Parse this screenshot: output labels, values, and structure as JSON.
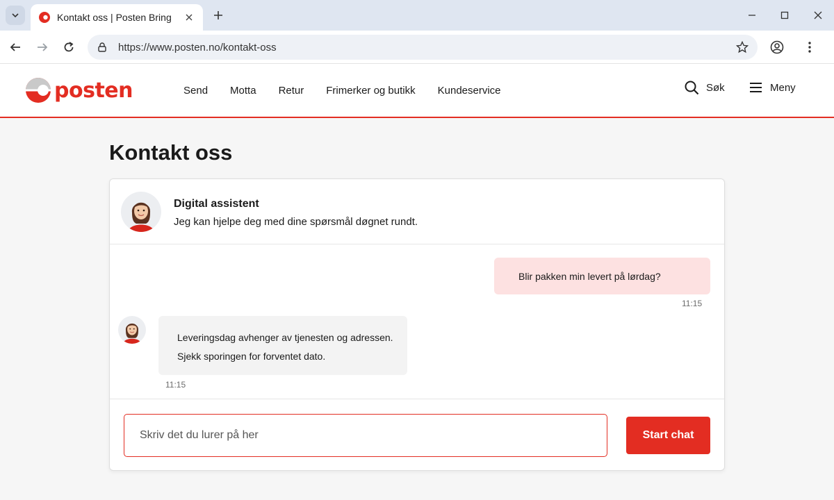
{
  "browser": {
    "tab_title": "Kontakt oss | Posten Bring",
    "url": "https://www.posten.no/kontakt-oss"
  },
  "header": {
    "logo_text": "posten",
    "nav": [
      "Send",
      "Motta",
      "Retur",
      "Frimerker og butikk",
      "Kundeservice"
    ],
    "search_label": "Søk",
    "menu_label": "Meny"
  },
  "page": {
    "title": "Kontakt oss"
  },
  "chat": {
    "assistant_name": "Digital assistent",
    "assistant_subtitle": "Jeg kan hjelpe deg med dine spørsmål døgnet rundt.",
    "user_message": "Blir pakken min levert på lørdag?",
    "user_time": "11:15",
    "bot_message_line1": "Leveringsdag avhenger av tjenesten og adressen.",
    "bot_message_line2": "Sjekk sporingen for forventet dato.",
    "bot_time": "11:15",
    "input_placeholder": "Skriv det du lurer på her",
    "start_button": "Start chat"
  },
  "colors": {
    "brand_red": "#e32d22",
    "user_bubble": "#fde1e1",
    "bot_bubble": "#f3f3f3"
  }
}
